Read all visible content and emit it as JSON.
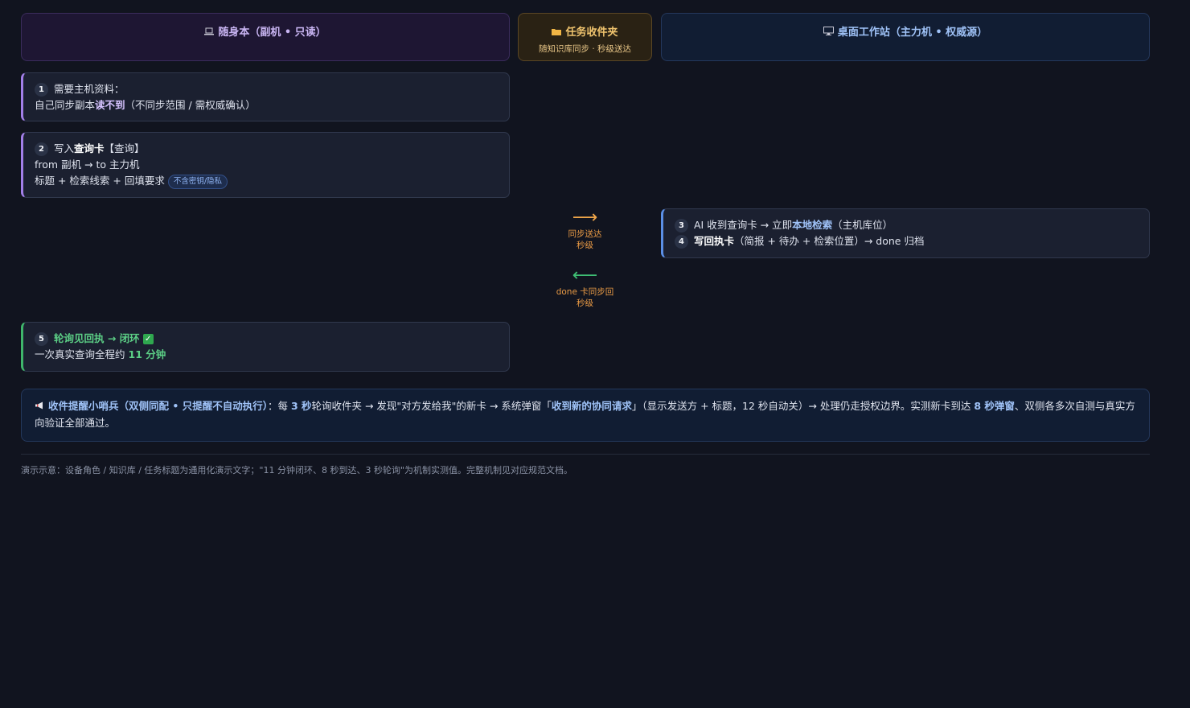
{
  "headers": {
    "left": {
      "icon": "laptop-icon",
      "title": "随身本（副机 • 只读）"
    },
    "mid": {
      "icon": "folder-icon",
      "title": "任务收件夹",
      "subtitle": "随知识库同步 · 秒级送达"
    },
    "right": {
      "icon": "monitor-icon",
      "title": "桌面工作站（主力机 • 权威源）"
    }
  },
  "step1": {
    "num": "1",
    "line1": "需要主机资料：",
    "line2_pre": "自己同步副本",
    "line2_hl": "读不到",
    "line2_post": "（不同步范围 / 需权威确认）"
  },
  "step2": {
    "num": "2",
    "line1_pre": "写入",
    "line1_hl": "查询卡",
    "line1_post": "【查询】",
    "line2": "from 副机 → to 主力机",
    "line3": "标题 + 检索线索 + 回填要求",
    "tag": "不含密钥/隐私"
  },
  "step3": {
    "num": "3",
    "pre": "AI 收到查询卡 → 立即",
    "hl": "本地检索",
    "post": "（主机库位）"
  },
  "step4": {
    "num": "4",
    "hl": "写回执卡",
    "post": "（简报 + 待办 + 检索位置）→ done 归档"
  },
  "flow_right": {
    "arrow": "⟶",
    "line1": "同步送达",
    "line2": "秒级"
  },
  "flow_left": {
    "arrow": "⟵",
    "line1": "done 卡同步回",
    "line2": "秒级"
  },
  "step5": {
    "num": "5",
    "title": "轮询见回执 → 闭环",
    "line2_pre": "一次真实查询全程约",
    "line2_hl": "11 分钟"
  },
  "banner": {
    "icon": "megaphone-icon",
    "title": "收件提醒小哨兵（双侧同配 • 只提醒不自动执行）",
    "t1": "：每",
    "h1": "3 秒",
    "t2": "轮询收件夹 → 发现\"对方发给我\"的新卡 → 系统弹窗「",
    "h2": "收到新的协同请求",
    "t3": "」（显示发送方 + 标题，12 秒自动关）→ 处理仍走授权边界。实测新卡到达",
    "h3": "8 秒弹窗",
    "t4": "、双侧各多次自测与真实方向验证全部通过。"
  },
  "footnote": "演示示意：设备角色 / 知识库 / 任务标题为通用化演示文字；\"11 分钟闭环、8 秒到达、3 秒轮询\"为机制实测值。完整机制见对应规范文档。"
}
